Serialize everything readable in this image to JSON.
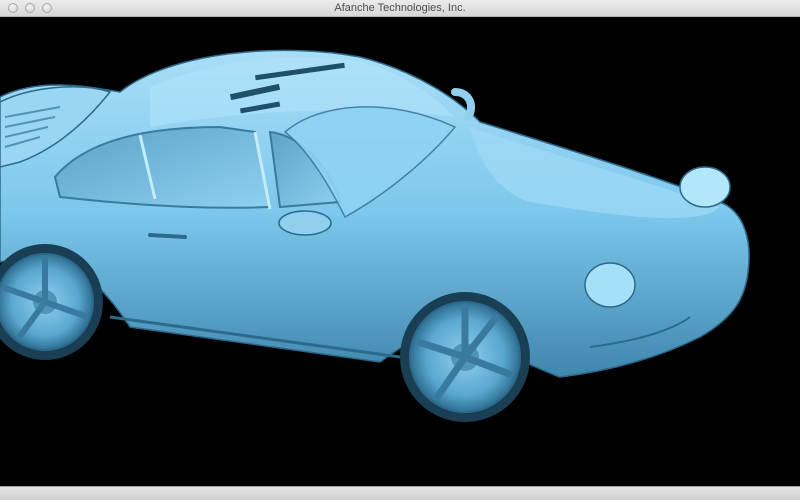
{
  "window": {
    "title": "Afanche Technologies, Inc."
  },
  "model": {
    "color": "#7cc7ec"
  }
}
